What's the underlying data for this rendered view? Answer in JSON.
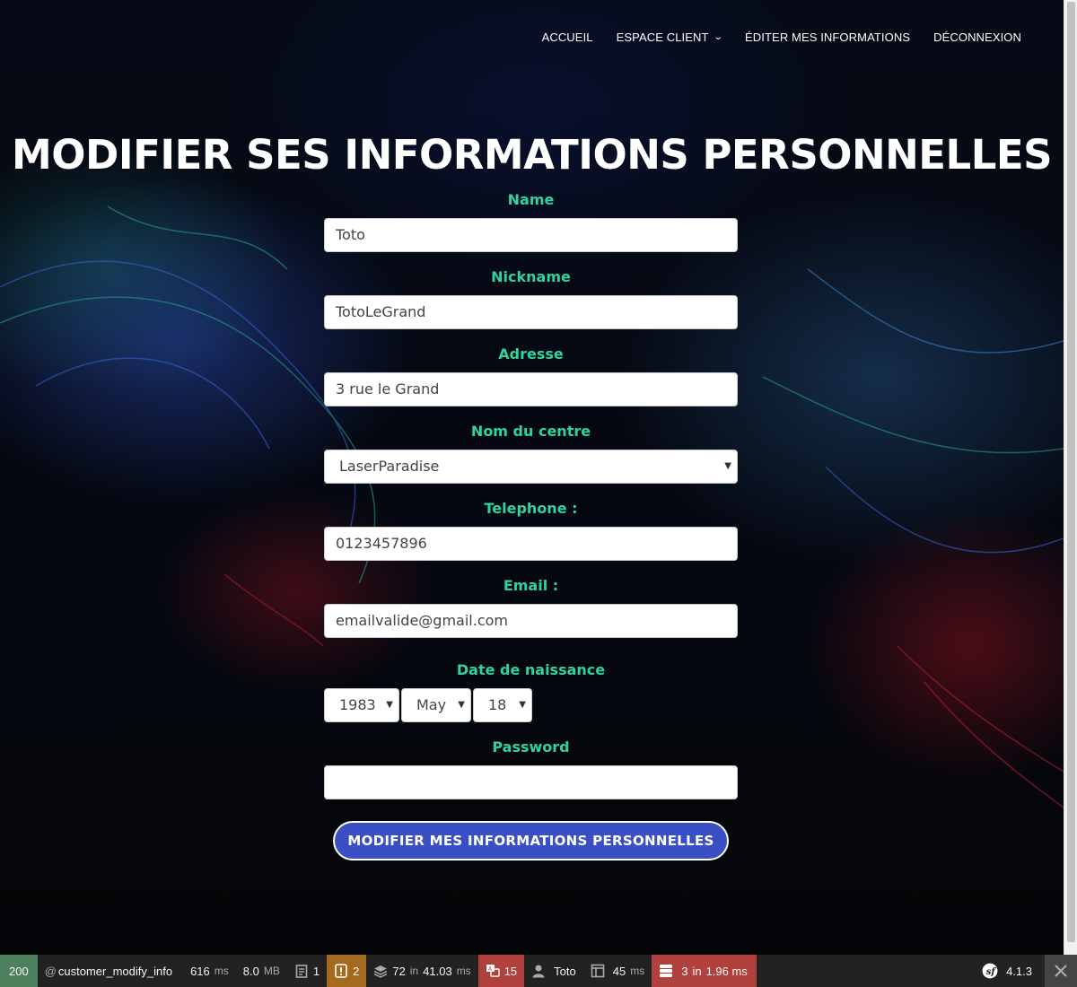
{
  "nav": {
    "items": [
      {
        "label": "ACCUEIL"
      },
      {
        "label": "ESPACE CLIENT",
        "has_dropdown": true
      },
      {
        "label": "ÉDITER MES INFORMATIONS"
      },
      {
        "label": "DÉCONNEXION"
      }
    ]
  },
  "page": {
    "title": "MODIFIER SES INFORMATIONS PERSONNELLES"
  },
  "form": {
    "name": {
      "label": "Name",
      "value": "Toto"
    },
    "nickname": {
      "label": "Nickname",
      "value": "TotoLeGrand"
    },
    "adresse": {
      "label": "Adresse",
      "value": "3 rue le Grand"
    },
    "centre": {
      "label": "Nom du centre",
      "value": "LaserParadise"
    },
    "telephone": {
      "label": "Telephone :",
      "value": "0123457896"
    },
    "email": {
      "label": "Email :",
      "value": "emailvalide@gmail.com"
    },
    "birthdate": {
      "label": "Date de naissance",
      "year": "1983",
      "month": "May",
      "day": "18"
    },
    "password": {
      "label": "Password",
      "value": ""
    },
    "submit_label": "MODIFIER MES INFORMATIONS PERSONNELLES"
  },
  "colors": {
    "label_green": "#2fd39c",
    "button_blue": "#3b4fc4",
    "toolbar_bg": "#222222",
    "status_green": "#4f805d",
    "warn_orange": "#a46a1f",
    "error_red": "#b0413e"
  },
  "debug_toolbar": {
    "status_code": "200",
    "route_prefix": "@",
    "route": "customer_modify_info",
    "time_value": "616",
    "time_unit": "ms",
    "memory_value": "8.0",
    "memory_unit": "MB",
    "forms_count": "1",
    "logs_count": "2",
    "cache_calls": "72",
    "cache_in": "in",
    "cache_time": "41.03",
    "cache_unit": "ms",
    "translation_count": "15",
    "user": "Toto",
    "twig_time": "45",
    "twig_unit": "ms",
    "db_queries": "3",
    "db_in": "in",
    "db_time": "1.96 ms",
    "symfony_version": "4.1.3"
  }
}
